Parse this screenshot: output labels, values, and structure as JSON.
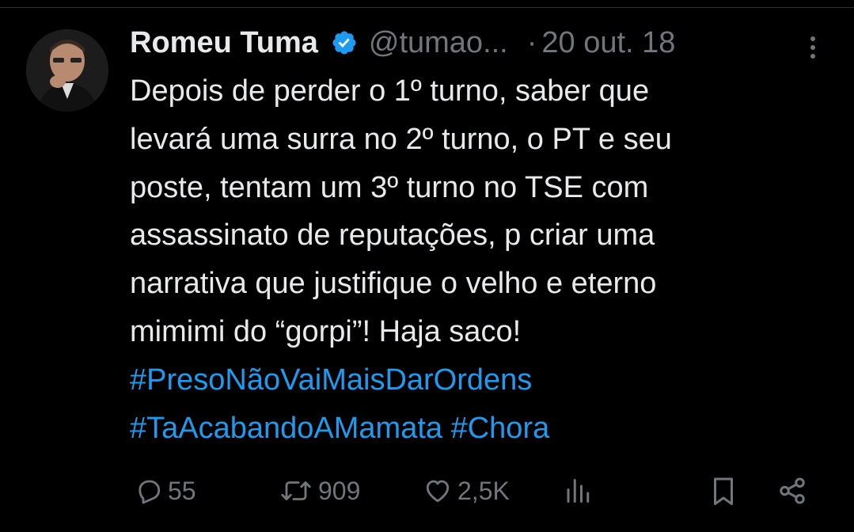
{
  "tweet": {
    "author_name": "Romeu Tuma",
    "handle": "@tumao...",
    "separator": "·",
    "date": "20 out. 18",
    "text_lines": [
      "Depois de perder o 1º turno, saber que",
      "levará uma surra no 2º turno, o PT e seu",
      "poste, tentam um 3º turno no TSE com",
      "assassinato de reputações, p criar uma",
      "narrativa que justifique o velho e eterno",
      "mimimi do “gorpi”! Haja saco!"
    ],
    "hashtag_lines": [
      [
        "#PresoNãoVaiMaisDarOrdens"
      ],
      [
        "#TaAcabandoAMamata",
        "#Chora"
      ]
    ]
  },
  "actions": {
    "replies": "55",
    "retweets": "909",
    "likes": "2,5K"
  },
  "icons": {
    "verified": "verified-badge-icon",
    "more": "more-vertical-icon",
    "reply": "reply-icon",
    "retweet": "retweet-icon",
    "like": "heart-icon",
    "views": "views-icon",
    "bookmark": "bookmark-icon",
    "share": "share-icon"
  },
  "colors": {
    "background": "#000000",
    "text": "#e7e9ea",
    "secondary": "#71767b",
    "accent": "#1d9bf0"
  }
}
